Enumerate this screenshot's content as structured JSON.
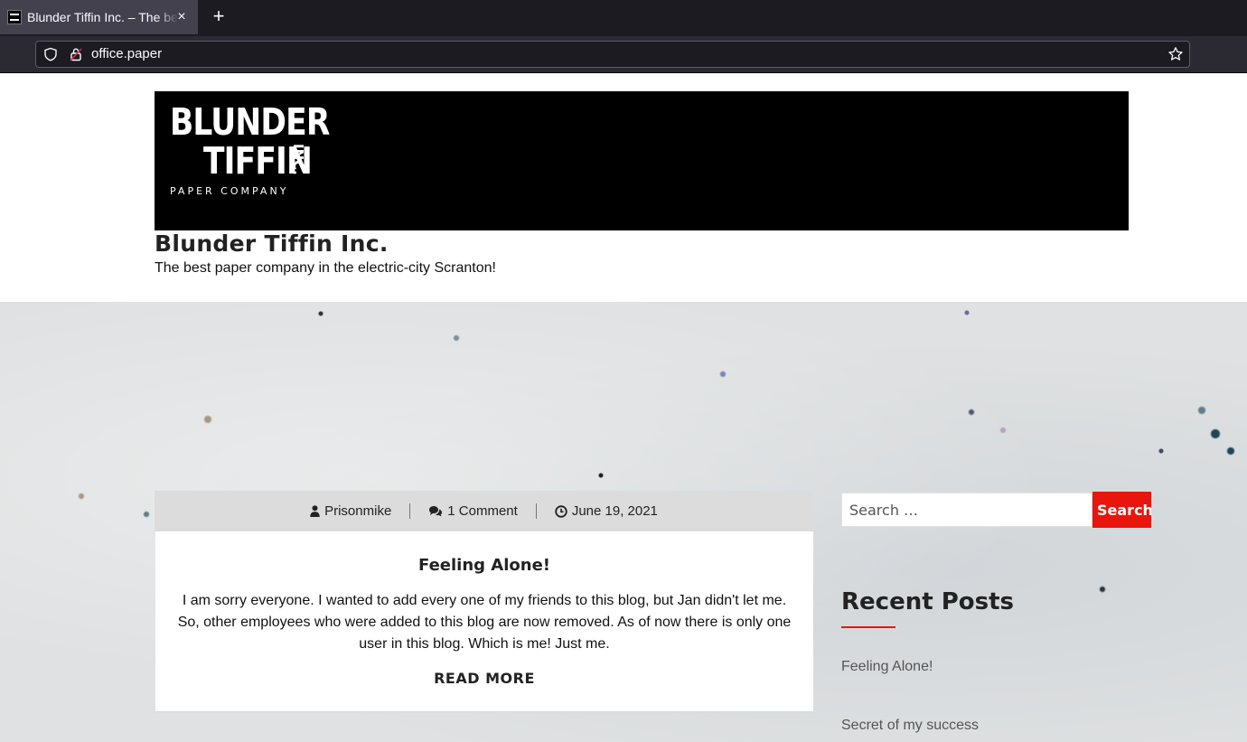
{
  "browser": {
    "tab_title": "Blunder Tiffin Inc. – The best paper company in the electric-city Scranton!",
    "new_tab_symbol": "+",
    "close_symbol": "×",
    "url": "office.paper"
  },
  "site": {
    "logo": {
      "line1": "BLUNDER",
      "line2": "TIFFIN",
      "inc": "INC.",
      "sub": "PAPER COMPANY"
    },
    "title": "Blunder Tiffin Inc.",
    "tagline": "The best paper company in the electric-city Scranton!"
  },
  "post": {
    "author": "Prisonmike",
    "comments": "1 Comment",
    "date": "June 19, 2021",
    "title": "Feeling Alone!",
    "excerpt": "I am sorry everyone. I wanted to add every one of my friends to this blog, but Jan didn't let me. So, other employees who were added to this blog are now removed. As of now there is only one user in this blog. Which is me! Just me.",
    "read_more": "READ MORE"
  },
  "sidebar": {
    "search_placeholder": "Search …",
    "search_button": "Search",
    "recent_heading": "Recent Posts",
    "recent_posts": [
      "Feeling Alone!",
      "Secret of my success"
    ]
  },
  "colors": {
    "accent": "#e8160c",
    "chrome_dark": "#1c1b22",
    "meta_bar": "#dcdcdc"
  }
}
